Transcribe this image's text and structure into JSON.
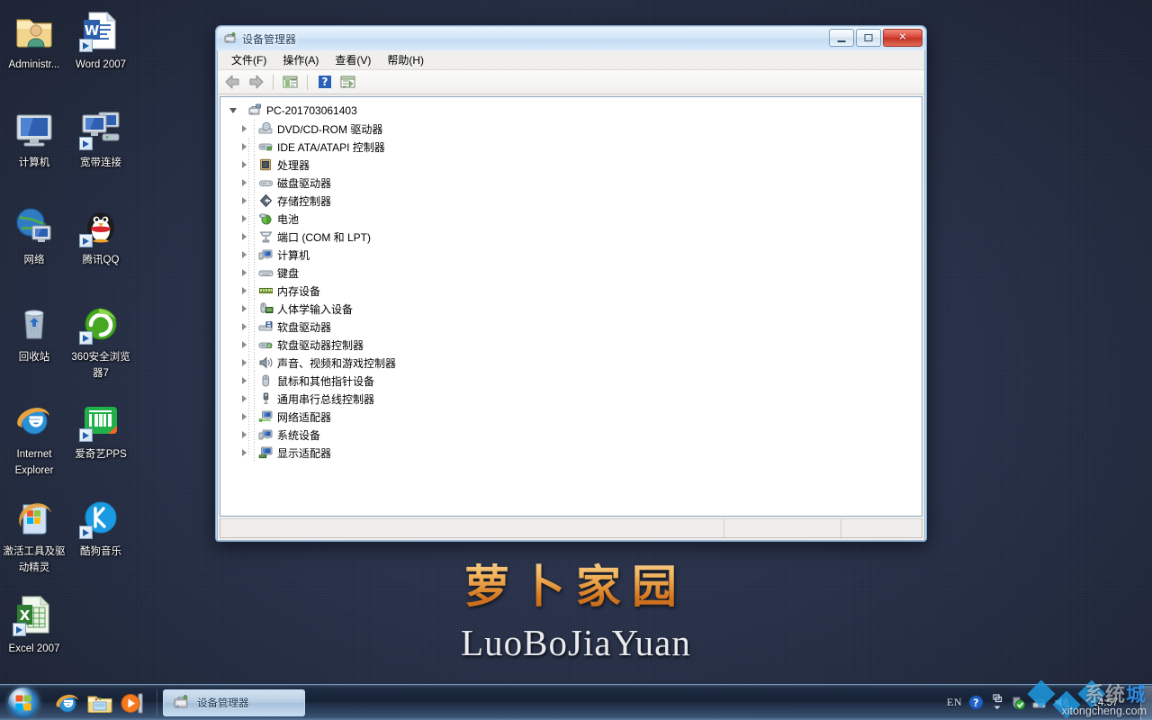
{
  "desktop": {
    "wallpaper": {
      "logo_cn": "萝卜家园",
      "logo_en": "LuoBoJiaYuan",
      "bg_color": "#29324a"
    },
    "icons": [
      {
        "label": "Administr...",
        "icon": "user-folder-icon",
        "shortcut": false
      },
      {
        "label": "Word 2007",
        "icon": "word-icon",
        "shortcut": true
      },
      {
        "label": "计算机",
        "icon": "computer-icon",
        "shortcut": false
      },
      {
        "label": "宽带连接",
        "icon": "broadband-connection-icon",
        "shortcut": true
      },
      {
        "label": "网络",
        "icon": "network-globe-icon",
        "shortcut": false
      },
      {
        "label": "腾讯QQ",
        "icon": "qq-penguin-icon",
        "shortcut": true
      },
      {
        "label": "回收站",
        "icon": "recycle-bin-icon",
        "shortcut": false
      },
      {
        "label": "360安全浏览器7",
        "icon": "360-browser-icon",
        "shortcut": true
      },
      {
        "label": "Internet Explorer",
        "icon": "internet-explorer-icon",
        "shortcut": false
      },
      {
        "label": "爱奇艺PPS",
        "icon": "iqiyi-pps-icon",
        "shortcut": true
      },
      {
        "label": "激活工具及驱动精灵",
        "icon": "activation-tool-icon",
        "shortcut": false
      },
      {
        "label": "酷狗音乐",
        "icon": "kugou-music-icon",
        "shortcut": true
      },
      {
        "label": "Excel 2007",
        "icon": "excel-icon",
        "shortcut": true
      }
    ]
  },
  "window": {
    "title": "设备管理器",
    "title_icon": "device-manager-icon",
    "controls": {
      "minimize": "–",
      "maximize": "□",
      "close": "✕"
    },
    "menu": [
      {
        "label": "文件(F)",
        "name": "menu-file"
      },
      {
        "label": "操作(A)",
        "name": "menu-action"
      },
      {
        "label": "查看(V)",
        "name": "menu-view"
      },
      {
        "label": "帮助(H)",
        "name": "menu-help"
      }
    ],
    "toolbar": [
      {
        "name": "back-button",
        "icon": "arrow-left-icon"
      },
      {
        "name": "forward-button",
        "icon": "arrow-right-icon"
      },
      {
        "name": "separator-1",
        "icon": "separator"
      },
      {
        "name": "show-hide-console-tree-button",
        "icon": "console-tree-icon"
      },
      {
        "name": "separator-2",
        "icon": "separator"
      },
      {
        "name": "help-button",
        "icon": "question-mark-icon"
      },
      {
        "name": "properties-button",
        "icon": "properties-panel-icon"
      }
    ],
    "tree": {
      "root": {
        "label": "PC-201703061403",
        "icon": "computer-node-icon",
        "expanded": true
      },
      "nodes": [
        {
          "label": "DVD/CD-ROM 驱动器",
          "icon": "dvd-drive-icon",
          "expandable": true
        },
        {
          "label": "IDE ATA/ATAPI 控制器",
          "icon": "ide-controller-icon",
          "expandable": true
        },
        {
          "label": "处理器",
          "icon": "processor-icon",
          "expandable": true
        },
        {
          "label": "磁盘驱动器",
          "icon": "disk-drive-icon",
          "expandable": true
        },
        {
          "label": "存储控制器",
          "icon": "storage-controller-icon",
          "expandable": true
        },
        {
          "label": "电池",
          "icon": "battery-icon",
          "expandable": true
        },
        {
          "label": "端口 (COM 和 LPT)",
          "icon": "ports-icon",
          "expandable": true
        },
        {
          "label": "计算机",
          "icon": "computer-device-icon",
          "expandable": true
        },
        {
          "label": "键盘",
          "icon": "keyboard-icon",
          "expandable": true
        },
        {
          "label": "内存设备",
          "icon": "memory-device-icon",
          "expandable": true
        },
        {
          "label": "人体学输入设备",
          "icon": "hid-device-icon",
          "expandable": true
        },
        {
          "label": "软盘驱动器",
          "icon": "floppy-drive-icon",
          "expandable": true
        },
        {
          "label": "软盘驱动器控制器",
          "icon": "floppy-controller-icon",
          "expandable": true
        },
        {
          "label": "声音、视频和游戏控制器",
          "icon": "sound-video-game-icon",
          "expandable": true
        },
        {
          "label": "鼠标和其他指针设备",
          "icon": "mouse-icon",
          "expandable": true
        },
        {
          "label": "通用串行总线控制器",
          "icon": "usb-controller-icon",
          "expandable": true
        },
        {
          "label": "网络适配器",
          "icon": "network-adapter-icon",
          "expandable": true
        },
        {
          "label": "系统设备",
          "icon": "system-device-icon",
          "expandable": true
        },
        {
          "label": "显示适配器",
          "icon": "display-adapter-icon",
          "expandable": true
        }
      ]
    },
    "statusbar": {
      "cell1": "",
      "cell2": "",
      "cell3": ""
    }
  },
  "taskbar": {
    "start_button": "start-orb",
    "quick_launch": [
      {
        "name": "ql-internet-explorer",
        "icon": "internet-explorer-icon"
      },
      {
        "name": "ql-windows-explorer",
        "icon": "folder-icon"
      },
      {
        "name": "ql-media-player",
        "icon": "media-player-icon"
      }
    ],
    "task_items": [
      {
        "label": "设备管理器",
        "icon": "device-manager-icon",
        "active": true
      }
    ],
    "tray": {
      "language": "EN",
      "icons": [
        {
          "name": "help-tray-icon",
          "icon": "question-circle-icon"
        },
        {
          "name": "show-hidden-icons",
          "icon": "chevron-up-icon"
        },
        {
          "name": "security-tray-icon",
          "icon": "shield-check-icon"
        },
        {
          "name": "network-tray-icon",
          "icon": "network-icon"
        },
        {
          "name": "volume-tray-icon",
          "icon": "speaker-icon"
        }
      ],
      "clock": "14:57"
    }
  },
  "watermark": {
    "cn_left": "系统",
    "cn_right": "城",
    "en": "xitongcheng.com"
  }
}
